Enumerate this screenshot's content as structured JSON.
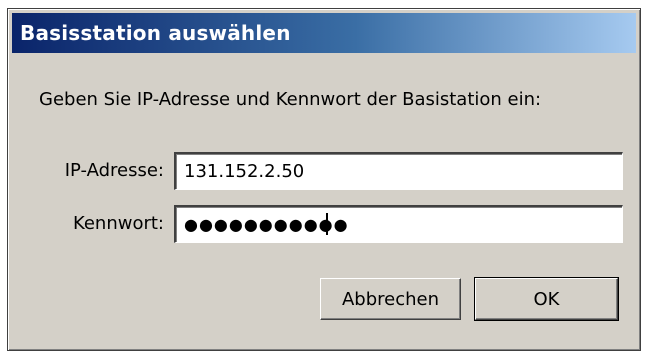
{
  "window": {
    "title": "Basisstation auswählen"
  },
  "instruction": "Geben Sie IP-Adresse und Kennwort der Basistation ein:",
  "fields": {
    "ip": {
      "label": "IP-Adresse:",
      "value": "131.152.2.50"
    },
    "password": {
      "label": "Kennwort:",
      "masked_value": "●●●●●●●●●●●"
    }
  },
  "buttons": {
    "cancel_label": "Abbrechen",
    "ok_label": "OK"
  },
  "colors": {
    "dialog_background": "#d4d0c8",
    "title_gradient_start": "#0a246a",
    "title_gradient_end": "#a6caf0",
    "title_text": "#ffffff"
  }
}
